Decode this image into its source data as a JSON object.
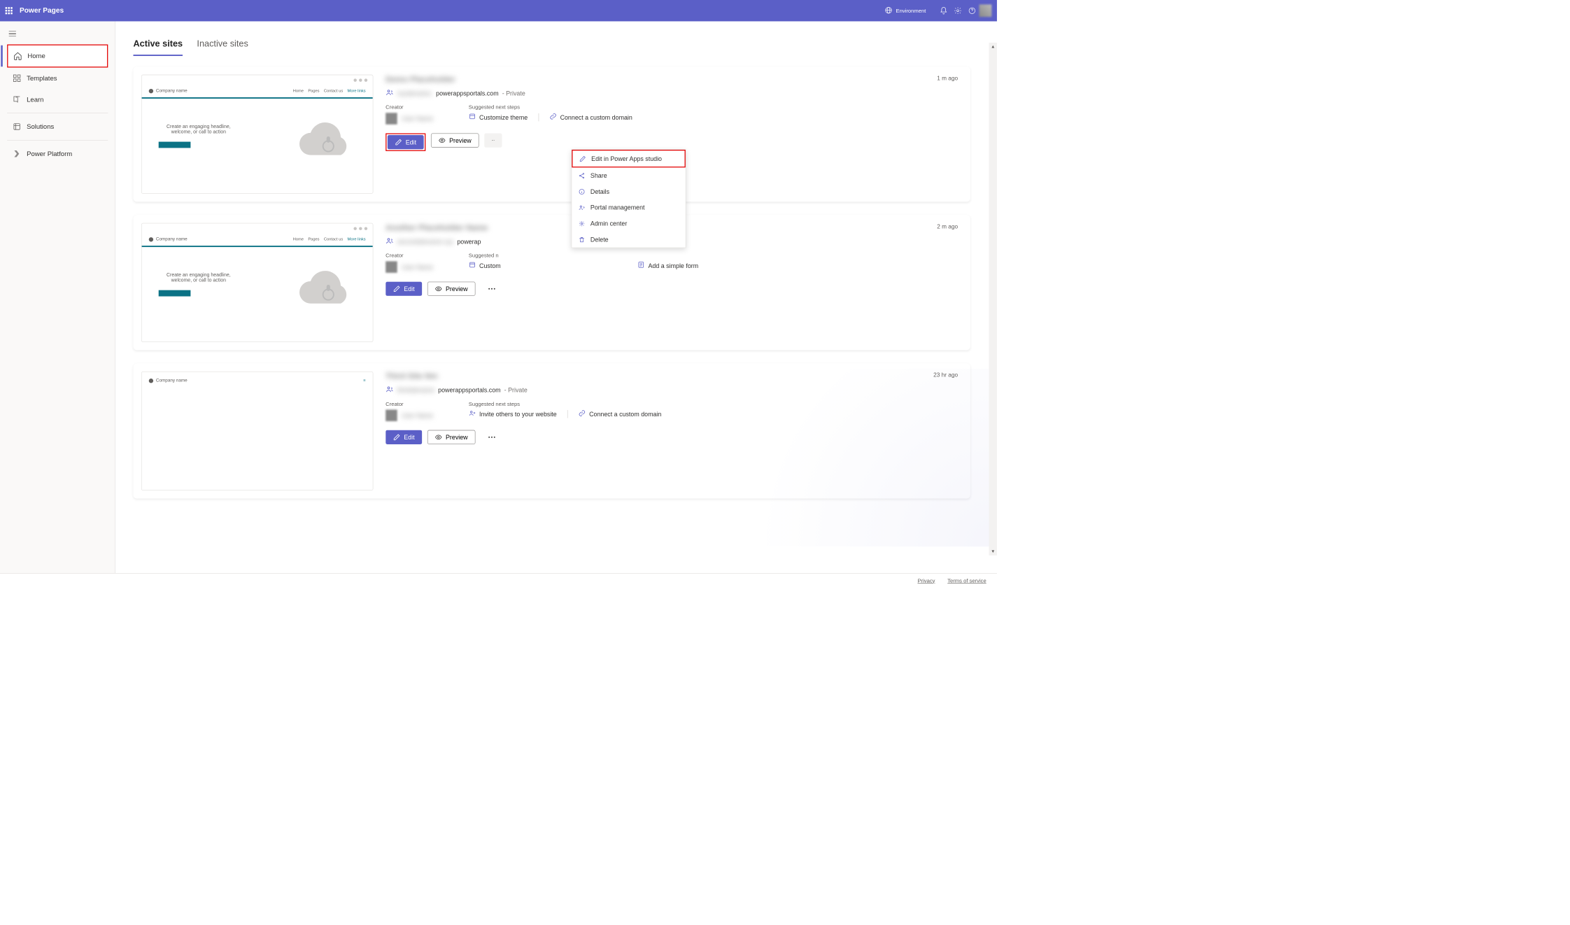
{
  "header": {
    "title": "Power Pages",
    "env_label": "Environment"
  },
  "sidebar": {
    "items": [
      {
        "label": "Home"
      },
      {
        "label": "Templates"
      },
      {
        "label": "Learn"
      },
      {
        "label": "Solutions"
      },
      {
        "label": "Power Platform"
      }
    ]
  },
  "tabs": {
    "active": "Active sites",
    "inactive": "Inactive sites"
  },
  "thumb": {
    "company": "Company name",
    "nav": [
      "Home",
      "Pages",
      "Contact us"
    ],
    "more": "More links",
    "headline": "Create an engaging headline, welcome, or call to action"
  },
  "sites": [
    {
      "title_blur": "Demo Placeholder",
      "url_blur": "mysitename.",
      "domain": "powerappsportals.com",
      "privacy": " - Private",
      "time": "1 m ago",
      "creator_label": "Creator",
      "creator_blur": "User Name",
      "steps_label": "Suggested next steps",
      "step1": "Customize theme",
      "step2": "Connect a custom domain",
      "edit": "Edit",
      "preview": "Preview"
    },
    {
      "title_blur": "Another Placeholder Name",
      "url_blur": "secondsitename xyz",
      "domain_partial": "powerap",
      "time": "2 m ago",
      "creator_label": "Creator",
      "creator_blur": "User Name",
      "steps_label": "Suggested n",
      "step1": "Custom",
      "step2": "Add a simple form",
      "edit": "Edit",
      "preview": "Preview"
    },
    {
      "title_blur": "Third Site Nm",
      "url_blur": "thirdsitename",
      "domain": "powerappsportals.com",
      "privacy": " - Private",
      "time": "23 hr ago",
      "creator_label": "Creator",
      "creator_blur": "User Name",
      "steps_label": "Suggested next steps",
      "step1": "Invite others to your website",
      "step2": "Connect a custom domain",
      "edit": "Edit",
      "preview": "Preview"
    }
  ],
  "menu": {
    "edit_studio": "Edit in Power Apps studio",
    "share": "Share",
    "details": "Details",
    "portal": "Portal management",
    "admin": "Admin center",
    "delete": "Delete"
  },
  "footer": {
    "privacy": "Privacy",
    "terms": "Terms of service"
  }
}
